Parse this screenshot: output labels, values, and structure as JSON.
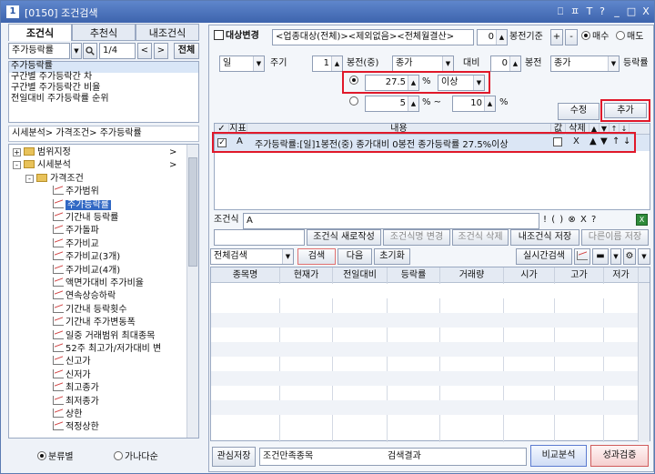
{
  "window": {
    "number": "1",
    "title": "[0150] 조건검색",
    "title_buttons": [
      "⎕",
      "ㅍ",
      "T",
      "?",
      "_",
      "□",
      "X"
    ]
  },
  "tabs": [
    {
      "label": "조건식",
      "active": true
    },
    {
      "label": "추천식",
      "active": false
    },
    {
      "label": "내조건식",
      "active": false
    }
  ],
  "left_toolbar": {
    "search_value": "주가등락률",
    "page": "1/4",
    "prev": "<",
    "next": ">",
    "all": "전체"
  },
  "results_list": [
    "주가등락률",
    "구간별 주가등락간 차",
    "구간별 주가등락간 비율",
    "전일대비 주가등락률 순위"
  ],
  "breadcrumb": "시세분석> 가격조건> 주가등락률",
  "tree": [
    {
      "label": "범위지정",
      "kind": "folder",
      "level": 0,
      "expand": "+",
      "arrow": ">"
    },
    {
      "label": "시세분석",
      "kind": "folder",
      "level": 0,
      "expand": "-",
      "arrow": ">"
    },
    {
      "label": "가격조건",
      "kind": "folder",
      "level": 1,
      "expand": "-"
    },
    {
      "label": "주가범위",
      "kind": "item",
      "level": 2
    },
    {
      "label": "주가등락률",
      "kind": "item",
      "level": 2,
      "selected": true
    },
    {
      "label": "기간내 등락률",
      "kind": "item",
      "level": 2
    },
    {
      "label": "주가돌파",
      "kind": "item",
      "level": 2
    },
    {
      "label": "주가비교",
      "kind": "item",
      "level": 2
    },
    {
      "label": "주가비교(3개)",
      "kind": "item",
      "level": 2
    },
    {
      "label": "주가비교(4개)",
      "kind": "item",
      "level": 2
    },
    {
      "label": "액면가대비 주가비율",
      "kind": "item",
      "level": 2
    },
    {
      "label": "연속상승하락",
      "kind": "item",
      "level": 2
    },
    {
      "label": "기간내 등락횟수",
      "kind": "item",
      "level": 2
    },
    {
      "label": "기간내 주가변동폭",
      "kind": "item",
      "level": 2
    },
    {
      "label": "일중 거래범위 최대종목",
      "kind": "item",
      "level": 2
    },
    {
      "label": "52주 최고가/저가대비 변",
      "kind": "item",
      "level": 2
    },
    {
      "label": "신고가",
      "kind": "item",
      "level": 2
    },
    {
      "label": "신저가",
      "kind": "item",
      "level": 2
    },
    {
      "label": "최고종가",
      "kind": "item",
      "level": 2
    },
    {
      "label": "최저종가",
      "kind": "item",
      "level": 2
    },
    {
      "label": "상한",
      "kind": "item",
      "level": 2
    },
    {
      "label": "적정상한",
      "kind": "item",
      "level": 2
    }
  ],
  "left_bottom": {
    "opt1": "분류별",
    "opt2": "가나다순"
  },
  "target": {
    "change_label": "대상변경",
    "target_text": "<업종대상(전체)><제외없음><전체월결산>",
    "bong_value": "0",
    "bong_label": "봉전기준",
    "plus": "+",
    "minus": "-",
    "buy": "매수",
    "sell": "매도"
  },
  "condition": {
    "period": "일",
    "period_label": "주기",
    "bong1": "1",
    "bong1_label": "봉전(중)",
    "price1": "종가",
    "vs_label": "대비",
    "bong2": "0",
    "bong2_label": "봉전",
    "price2": "종가",
    "rate_label": "등락률",
    "value1": "27.5",
    "pct1": "%",
    "cond1": "이상",
    "value2a": "5",
    "pct2": "% ~",
    "value2b": "10",
    "pct3": "%",
    "edit_button": "수정",
    "add_button": "추가"
  },
  "cond_table": {
    "headers": [
      "지표",
      "내용",
      "값",
      "삭제"
    ],
    "move_buttons": [
      "▲",
      "▼",
      "↑",
      "↓"
    ],
    "rows": [
      {
        "id": "A",
        "content": "주가등락률:[일]1봉전(중) 종가대비 0봉전 종가등락률 27.5%이상",
        "delete": "X"
      }
    ]
  },
  "formula": {
    "label": "조건식",
    "value": "A",
    "ops": [
      "!",
      "(",
      ")",
      "⊗",
      "X",
      "?"
    ],
    "buttons": [
      "조건식 새로작성",
      "조건식명 변경",
      "조건식 삭제",
      "내조건식 저장",
      "다른이름 저장"
    ]
  },
  "search_bar": {
    "scope": "전체검색",
    "search": "검색",
    "next": "다음",
    "reset": "초기화",
    "realtime": "실시간검색"
  },
  "result_table": {
    "headers": [
      "종목명",
      "현재가",
      "전일대비",
      "등락률",
      "거래량",
      "시가",
      "고가",
      "저가"
    ]
  },
  "footer": {
    "save_interest": "관심저장",
    "count_label": "조건만족종목",
    "result_label": "검색결과",
    "compare": "비교분석",
    "performance": "성과검증"
  },
  "colors": {
    "accent_red": "#e0182a",
    "title_blue": "#3d64ad"
  }
}
